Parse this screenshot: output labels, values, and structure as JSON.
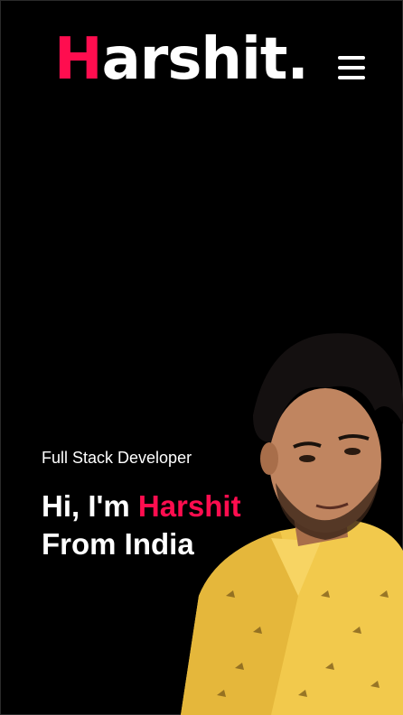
{
  "header": {
    "logo": {
      "first_letter": "H",
      "rest": "arshit",
      "dot": "."
    },
    "menu_icon": "hamburger-menu-icon"
  },
  "hero": {
    "subtitle": "Full Stack Developer",
    "greeting": "Hi, I'm",
    "name": "Harshit",
    "line2": "From India",
    "photo": "portrait-photo"
  },
  "colors": {
    "background": "#000000",
    "accent": "#ff0d4f",
    "text": "#ffffff",
    "shirt": "#f2c94c"
  }
}
